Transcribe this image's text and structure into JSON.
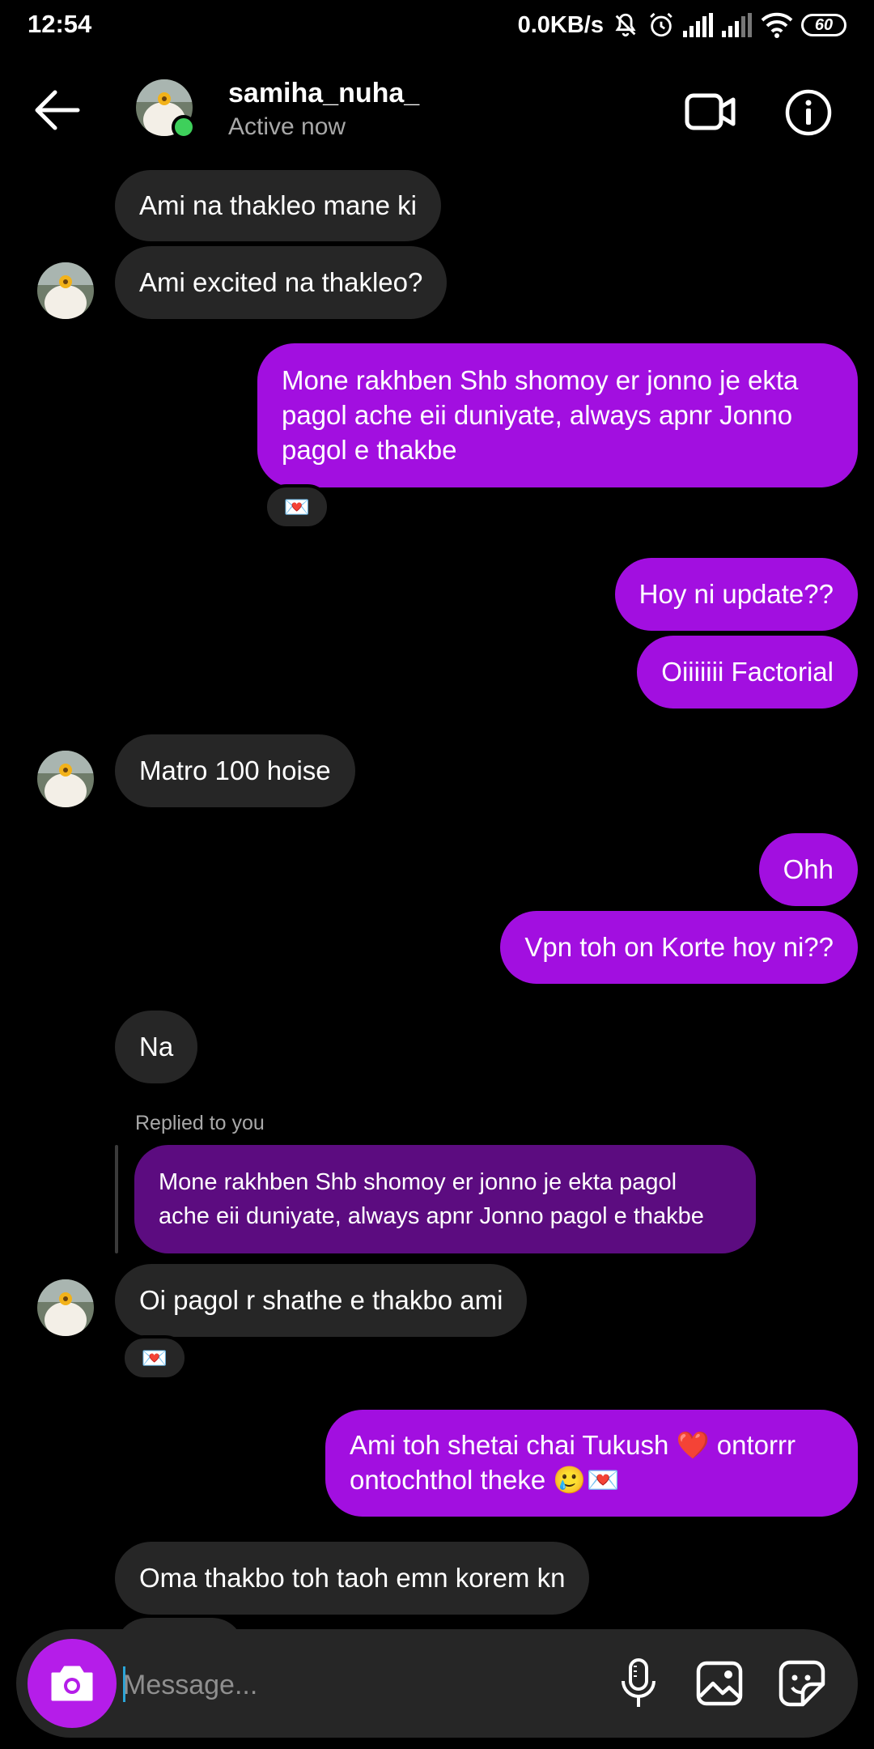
{
  "status_bar": {
    "time": "12:54",
    "net_speed": "0.0KB/s",
    "battery": "60"
  },
  "header": {
    "username": "samiha_nuha_",
    "status": "Active now"
  },
  "messages": [
    {
      "text": "Ami na thakleo mane ki"
    },
    {
      "text": "Ami excited na thakleo?"
    },
    {
      "text": "Mone rakhben Shb shomoy er jonno je ekta pagol ache eii duniyate, always apnr Jonno pagol e thakbe",
      "reaction": "💌"
    },
    {
      "text": "Hoy ni update??"
    },
    {
      "text": "Oiiiiiii Factorial"
    },
    {
      "text": "Matro 100 hoise"
    },
    {
      "text": "Ohh"
    },
    {
      "text": "Vpn toh on Korte hoy ni??"
    },
    {
      "text": "Na"
    },
    {
      "text": "Oi pagol r shathe e thakbo ami",
      "reaction": "💌",
      "reply": {
        "label": "Replied to you",
        "quoted": "Mone rakhben Shb shomoy er jonno je ekta pagol ache eii duniyate, always apnr Jonno pagol e thakbe"
      }
    },
    {
      "text": "Ami toh shetai chai Tukush ❤️ ontorrr ontochthol theke 🥲💌"
    },
    {
      "text": "Oma thakbo toh taoh emn korem kn"
    }
  ],
  "composer": {
    "placeholder": "Message..."
  },
  "colors": {
    "outgoing_bubble": "#a20fe0",
    "incoming_bubble": "#262626",
    "reply_bubble": "#5c0c80",
    "camera_button": "#b51de9",
    "online_dot": "#3ed05b"
  },
  "icons": [
    "back-arrow-icon",
    "video-call-icon",
    "info-icon",
    "camera-icon",
    "microphone-icon",
    "gallery-icon",
    "sticker-icon"
  ]
}
